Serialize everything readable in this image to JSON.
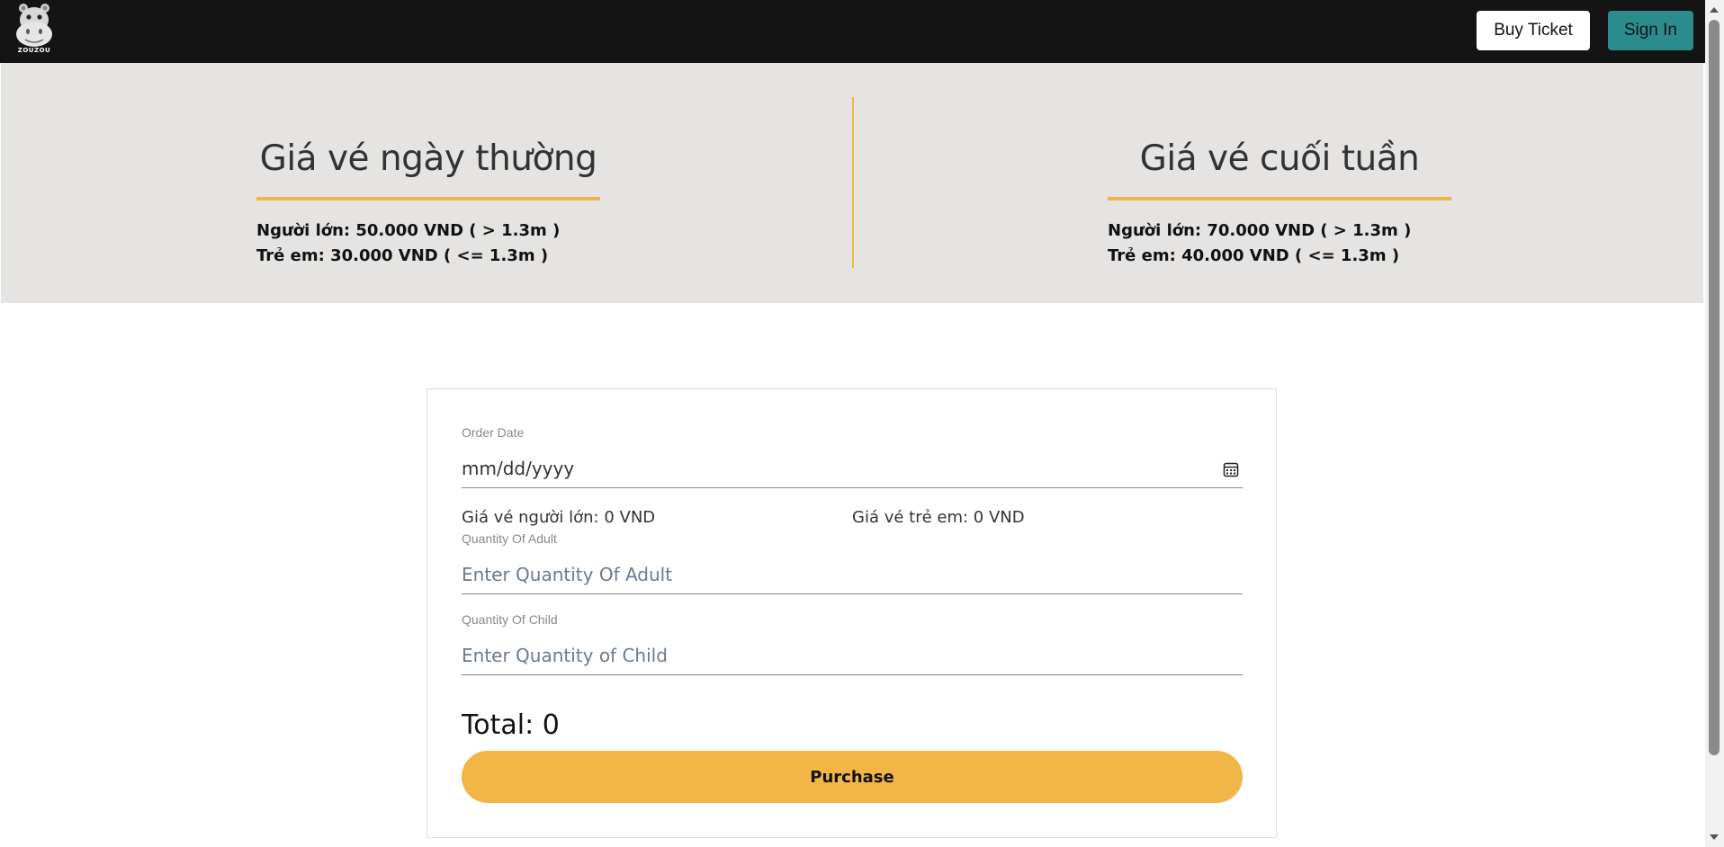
{
  "header": {
    "logo_text": "ZOUZOU",
    "buy_ticket_label": "Buy Ticket",
    "sign_in_label": "Sign In"
  },
  "prices": {
    "weekday": {
      "title": "Giá vé ngày thường",
      "adult": "Người lớn: 50.000 VND ( > 1.3m )",
      "child": "Trẻ em: 30.000 VND ( <= 1.3m )"
    },
    "weekend": {
      "title": "Giá vé cuối tuần",
      "adult": "Người lớn: 70.000 VND ( > 1.3m )",
      "child": "Trẻ em: 40.000 VND ( <= 1.3m )"
    }
  },
  "form": {
    "order_date_label": "Order Date",
    "order_date_value": "mm/dd/yyyy",
    "adult_price_text": "Giá vé người lớn: 0 VND",
    "child_price_text": "Giá vé trẻ em: 0 VND",
    "adult_qty_label": "Quantity Of Adult",
    "adult_qty_placeholder": "Enter Quantity Of Adult",
    "child_qty_label": "Quantity Of Child",
    "child_qty_placeholder": "Enter Quantity of Child",
    "total_text": "Total: 0",
    "purchase_label": "Purchase"
  },
  "colors": {
    "header_bg": "#141414",
    "accent": "#f0b447",
    "sign_in_bg": "#2a8c8c",
    "band_bg": "#e5e4e2"
  }
}
